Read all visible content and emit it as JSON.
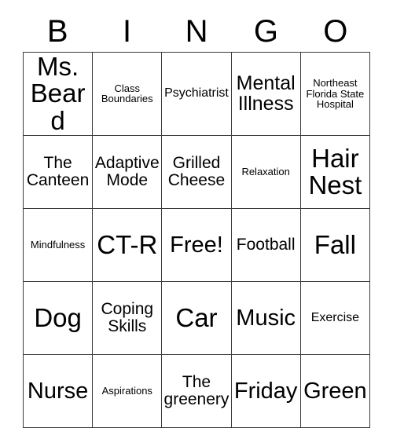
{
  "header": {
    "letters": [
      "B",
      "I",
      "N",
      "G",
      "O"
    ]
  },
  "grid": {
    "rows": [
      [
        {
          "text": "Ms. Beard",
          "size": "fs-xxl"
        },
        {
          "text": "Class Boundaries",
          "size": "fs-xs"
        },
        {
          "text": "Psychiatrist",
          "size": "fs-s"
        },
        {
          "text": "Mental Illness",
          "size": "fs-l"
        },
        {
          "text": "Northeast Florida State Hospital",
          "size": "fs-xs"
        }
      ],
      [
        {
          "text": "The Canteen",
          "size": "fs-m"
        },
        {
          "text": "Adaptive Mode",
          "size": "fs-m"
        },
        {
          "text": "Grilled Cheese",
          "size": "fs-m"
        },
        {
          "text": "Relaxation",
          "size": "fs-xs"
        },
        {
          "text": "Hair Nest",
          "size": "fs-xxl"
        }
      ],
      [
        {
          "text": "Mindfulness",
          "size": "fs-xs"
        },
        {
          "text": "CT-R",
          "size": "fs-xxl"
        },
        {
          "text": "Free!",
          "size": "fs-xl"
        },
        {
          "text": "Football",
          "size": "fs-m"
        },
        {
          "text": "Fall",
          "size": "fs-xxl"
        }
      ],
      [
        {
          "text": "Dog",
          "size": "fs-xxl"
        },
        {
          "text": "Coping Skills",
          "size": "fs-m"
        },
        {
          "text": "Car",
          "size": "fs-xxl"
        },
        {
          "text": "Music",
          "size": "fs-xl"
        },
        {
          "text": "Exercise",
          "size": "fs-s"
        }
      ],
      [
        {
          "text": "Nurse",
          "size": "fs-xl"
        },
        {
          "text": "Aspirations",
          "size": "fs-xs"
        },
        {
          "text": "The greenery",
          "size": "fs-m"
        },
        {
          "text": "Friday",
          "size": "fs-xl"
        },
        {
          "text": "Green",
          "size": "fs-xl"
        }
      ]
    ]
  }
}
